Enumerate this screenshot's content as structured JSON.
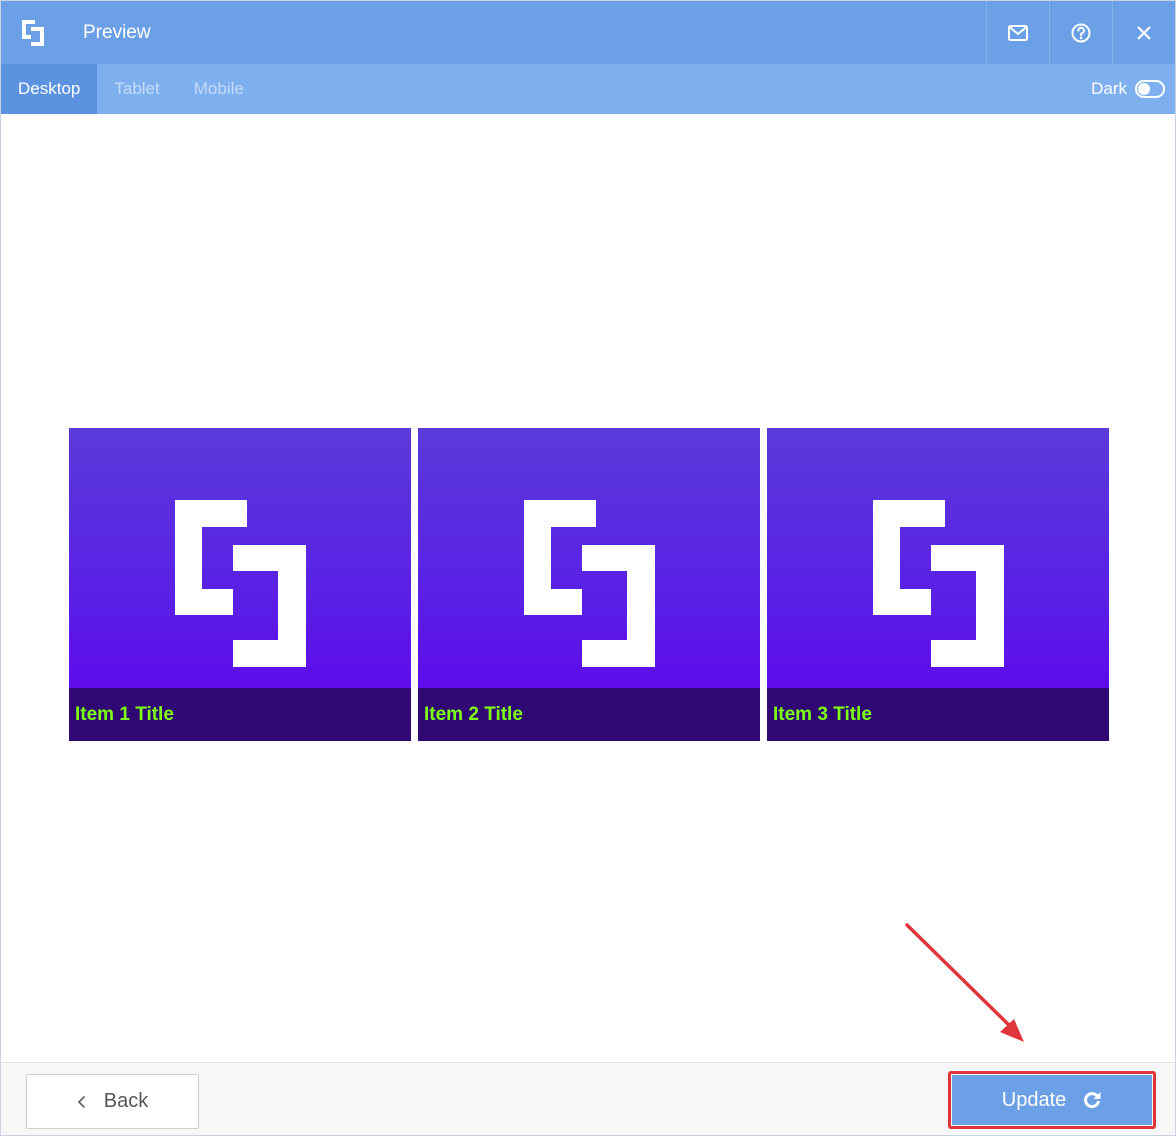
{
  "window": {
    "title": "Preview"
  },
  "titlebar": {
    "logo_icon": "app-logo-icon",
    "actions": [
      {
        "icon": "mail-icon"
      },
      {
        "icon": "help-icon"
      },
      {
        "icon": "close-icon"
      }
    ]
  },
  "tabs": [
    {
      "label": "Desktop",
      "active": true
    },
    {
      "label": "Tablet",
      "active": false
    },
    {
      "label": "Mobile",
      "active": false
    }
  ],
  "dark_mode": {
    "label": "Dark",
    "enabled": false
  },
  "gallery": {
    "items": [
      {
        "title": "Item 1 Title"
      },
      {
        "title": "Item 2 Title"
      },
      {
        "title": "Item 3 Title"
      }
    ]
  },
  "footer": {
    "back_label": "Back",
    "update_label": "Update"
  },
  "colors": {
    "titlebar": "#6b9fe6",
    "tabbar": "#7eb0f0",
    "card_gradient_start": "#5a3ad9",
    "card_gradient_end": "#6100ee",
    "caption_bg": "#300874",
    "caption_text": "#7cff12",
    "highlight": "#e0353a"
  }
}
